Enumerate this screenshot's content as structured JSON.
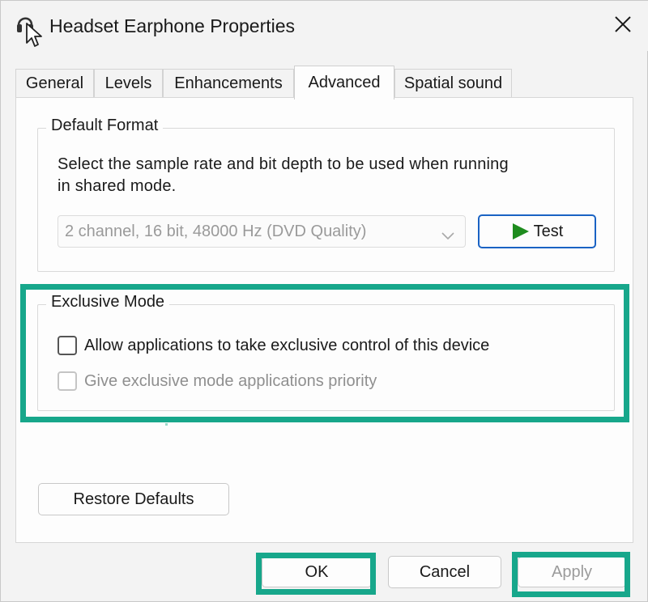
{
  "window": {
    "title": "Headset Earphone Properties",
    "title_icon": "headset-speaker-icon",
    "close_icon": "close-icon"
  },
  "tabs": [
    {
      "label": "General"
    },
    {
      "label": "Levels"
    },
    {
      "label": "Enhancements"
    },
    {
      "label": "Advanced",
      "active": true
    },
    {
      "label": "Spatial sound"
    }
  ],
  "default_format": {
    "legend": "Default Format",
    "description_line1": "Select the sample rate and bit depth to be used when running",
    "description_line2": "in shared mode.",
    "format_select_value": "2 channel, 16 bit, 48000 Hz (DVD Quality)",
    "test_button_label": "Test",
    "test_icon": "play-icon"
  },
  "exclusive_mode": {
    "legend": "Exclusive Mode",
    "allow_exclusive_label": "Allow applications to take exclusive control of this device",
    "allow_exclusive_checked": false,
    "priority_label": "Give exclusive mode applications priority",
    "priority_checked": false,
    "priority_enabled": false
  },
  "restore_defaults_label": "Restore Defaults",
  "footer": {
    "ok_label": "OK",
    "cancel_label": "Cancel",
    "apply_label": "Apply"
  },
  "colors": {
    "highlight": "#17a78b",
    "test_border": "#1a63c4",
    "play_icon": "#1e8c1e"
  }
}
